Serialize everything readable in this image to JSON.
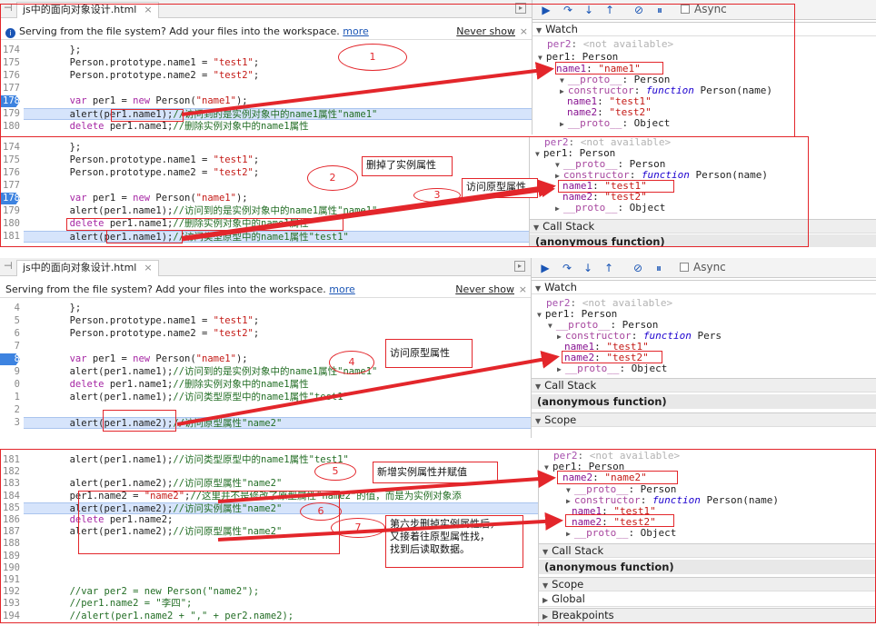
{
  "tab_title_a": "js中的面向对象设计.html",
  "tab_title_b": "js中的面向对象设计.html",
  "infobar": {
    "text": "Serving from the file system? Add your files into the workspace.",
    "more": "more",
    "never_show": "Never show"
  },
  "async_label": "Async",
  "panel1": {
    "lines": [
      {
        "n": "174",
        "c": "        };"
      },
      {
        "n": "175",
        "c": "        Person.prototype.name1 = \"test1\";"
      },
      {
        "n": "176",
        "c": "        Person.prototype.name2 = \"test2\";"
      },
      {
        "n": "177",
        "c": ""
      },
      {
        "n": "178",
        "c": "        var per1 = new Person(\"name1\");"
      },
      {
        "n": "179",
        "c": "        alert(per1.name1);//访问到的是实例对象中的name1属性\"name1\""
      },
      {
        "n": "180",
        "c": "        delete per1.name1;//删除实例对象中的name1属性"
      }
    ],
    "watch_title": "Watch",
    "watch": [
      "per2: <not available>",
      "per1: Person",
      "name1: \"name1\"",
      "__proto__: Person",
      "constructor: function Person(name)",
      "name1: \"test1\"",
      "name2: \"test2\"",
      "__proto__: Object"
    ],
    "callout_num": "1"
  },
  "panel2": {
    "lines": [
      {
        "n": "174",
        "c": "        };"
      },
      {
        "n": "175",
        "c": "        Person.prototype.name1 = \"test1\";"
      },
      {
        "n": "176",
        "c": "        Person.prototype.name2 = \"test2\";"
      },
      {
        "n": "177",
        "c": ""
      },
      {
        "n": "178",
        "c": "        var per1 = new Person(\"name1\");"
      },
      {
        "n": "179",
        "c": "        alert(per1.name1);//访问到的是实例对象中的name1属性\"name1\""
      },
      {
        "n": "180",
        "c": "        delete per1.name1;//删除实例对象中的name1属性"
      },
      {
        "n": "181",
        "c": "        alert(per1.name1);//访问类型原型中的name1属性\"test1\""
      }
    ],
    "watch": [
      "per2: <not available>",
      "per1: Person",
      "__proto__: Person",
      "constructor: function Person(name)",
      "name1: \"test1\"",
      "name2: \"test2\"",
      "__proto__: Object"
    ],
    "call_stack": "Call Stack",
    "anon": "(anonymous function)",
    "callout_num2": "2",
    "callout_num3": "3",
    "note_deleted": "删掉了实例属性",
    "note_proto": "访问原型属性"
  },
  "panel3": {
    "lines": [
      {
        "n": "4",
        "c": "        };"
      },
      {
        "n": "5",
        "c": "        Person.prototype.name1 = \"test1\";"
      },
      {
        "n": "6",
        "c": "        Person.prototype.name2 = \"test2\";"
      },
      {
        "n": "7",
        "c": ""
      },
      {
        "n": "8",
        "c": "        var per1 = new Person(\"name1\");"
      },
      {
        "n": "9",
        "c": "        alert(per1.name1);//访问到的是实例对象中的name1属性\"name1\""
      },
      {
        "n": "0",
        "c": "        delete per1.name1;//删除实例对象中的name1属性"
      },
      {
        "n": "1",
        "c": "        alert(per1.name1);//访问类型原型中的name1属性\"test1\""
      },
      {
        "n": "2",
        "c": ""
      },
      {
        "n": "3",
        "c": "        alert(per1.name2);//访问原型属性\"name2\""
      }
    ],
    "watch_title": "Watch",
    "watch": [
      "per2: <not available>",
      "per1: Person",
      "__proto__: Person",
      "constructor: function Pers",
      "name1: \"test1\"",
      "name2: \"test2\"",
      "__proto__: Object"
    ],
    "call_stack": "Call Stack",
    "anon": "(anonymous function)",
    "scope": "Scope",
    "callout_num": "4",
    "note": "访问原型属性"
  },
  "panel4": {
    "lines": [
      {
        "n": "181",
        "c": "        alert(per1.name1);//访问类型原型中的name1属性\"test1\""
      },
      {
        "n": "182",
        "c": ""
      },
      {
        "n": "183",
        "c": "        alert(per1.name2);//访问原型属性\"name2\""
      },
      {
        "n": "184",
        "c": "        per1.name2 = \"name2\";//这里并不是修改了原型属性\"name2\"的值，而是为实例对象添"
      },
      {
        "n": "185",
        "c": "        alert(per1.name2);//访问实例属性\"name2\""
      },
      {
        "n": "186",
        "c": "        delete per1.name2;"
      },
      {
        "n": "187",
        "c": "        alert(per1.name2);//访问原型属性\"name2\""
      },
      {
        "n": "188",
        "c": ""
      },
      {
        "n": "189",
        "c": ""
      },
      {
        "n": "190",
        "c": ""
      },
      {
        "n": "191",
        "c": ""
      },
      {
        "n": "192",
        "c": "        //var per2 = new Person(\"name2\");"
      },
      {
        "n": "193",
        "c": "        //per1.name2 = \"李四\";"
      },
      {
        "n": "194",
        "c": "        //alert(per1.name2 + \",\" + per2.name2);"
      }
    ],
    "watch": [
      "per2: <not available>",
      "per1: Person",
      "name2: \"name2\"",
      "__proto__: Person",
      "constructor: function Person(name)",
      "name1: \"test1\"",
      "name2: \"test2\"",
      "__proto__: Object"
    ],
    "call_stack": "Call Stack",
    "anon": "(anonymous function)",
    "scope": "Scope",
    "global": "Global",
    "breakpoints": "Breakpoints",
    "callout_num5": "5",
    "callout_num6": "6",
    "callout_num7": "7",
    "note_add": "新增实例属性并赋值",
    "note_step6": "第六步删掉实例属性后，\n又接着往原型属性找，\n找到后读取数据。"
  },
  "accent": "#e3262b"
}
